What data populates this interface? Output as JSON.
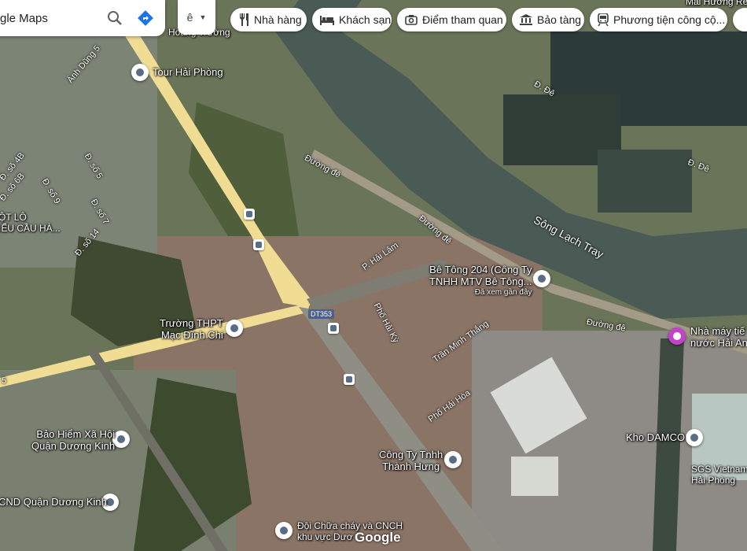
{
  "search": {
    "query": "gle Maps"
  },
  "lang_button": {
    "label": "ê"
  },
  "chips": [
    {
      "label": "Nhà hàng",
      "icon": "fork-knife-icon"
    },
    {
      "label": "Khách sạn",
      "icon": "bed-icon"
    },
    {
      "label": "Điểm tham quan",
      "icon": "camera-icon"
    },
    {
      "label": "Bảo tàng",
      "icon": "museum-icon"
    },
    {
      "label": "Phương tiện công cộ...",
      "icon": "train-icon"
    }
  ],
  "places": {
    "tour": "Tour Hải Phòng",
    "betong_1": "Bê Tông 204 (Công Ty",
    "betong_2": "TNHH MTV Bê Tông...",
    "betong_3": "Đã xem gần đây",
    "school_1": "Trường THPT",
    "school_2": "Mạc Đĩnh Chi",
    "baohiem_1": "Bảo Hiểm Xã Hội",
    "baohiem_2": "Quận Dương Kinh",
    "congty_1": "Công Ty Tnhh",
    "congty_2": "Thành Hưng",
    "damco": "Kho DAMCO",
    "sgs_1": "SGS Vietnam",
    "sgs_2": "Hải Phòng",
    "nhamay_1": "Nhà máy tiế",
    "nhamay_2": "nước Hải An",
    "ubnd": "CND Quận Dương Kinh",
    "doi_1": "Đội Chữa cháy và CNCH",
    "doi_2": "khu vực Dươ",
    "lo_1": "ỘT LÔ",
    "lo_2": "IỂU CẦU HÀ...",
    "hoang": "Hoàng Trường",
    "maihuong": "Mai Hương Re"
  },
  "roads": {
    "anhdung": "Ánh Dũng 5",
    "duongde_1": "Đường đê",
    "duongde_2": "Đường đê",
    "duongde_3": "Đường đê",
    "de_1": "Đ. Đê",
    "de_2": "Đ. Đê",
    "hailam": "P. Hải Lâm",
    "haiky": "Phố Hải Kỳ",
    "tranminhthang": "Trần Minh Thắng",
    "haihoa": "Phố Hải Hòa",
    "dt353": "DT353",
    "so4b": "Đ. số 4B",
    "so6b": "Đ. số 6B",
    "so9": "Đ. số 9",
    "so5": "Đ. số 5",
    "so7": "Đ. số 7",
    "so14": "Đ. số 14",
    "num5": "5"
  },
  "river": "Sông Lạch Tray",
  "logo": "Google",
  "colors": {
    "river": "#4a5a55",
    "highway": "#f0dd93",
    "poi_pin": "#5a6d86",
    "poi_purple": "#c043c8"
  }
}
